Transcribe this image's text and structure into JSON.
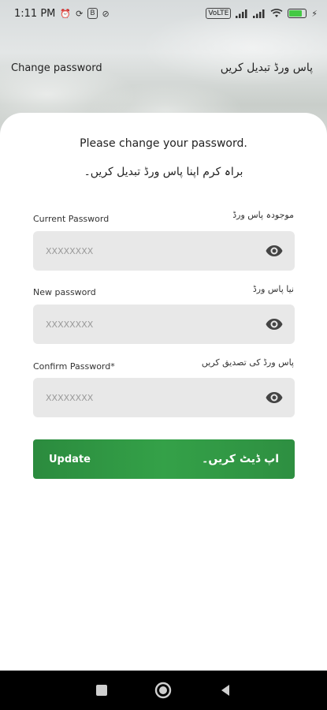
{
  "status_bar": {
    "time": "1:11 PM",
    "vo_lte": "VoLTE",
    "battery_level": 0.8,
    "icons": [
      "alarm-icon",
      "sync-icon",
      "b-icon",
      "vpn-icon",
      "signal-icon",
      "signal-icon",
      "wifi-icon",
      "battery-icon"
    ]
  },
  "header": {
    "title_en": "Change password",
    "title_ur": "پاس ورڈ تبدیل کریں"
  },
  "intro": {
    "heading_en": "Please change your password.",
    "heading_ur": "براہ کرم اپنا پاس ورڈ تبدیل کریں۔"
  },
  "fields": [
    {
      "label_en": "Current Password",
      "label_ur": "موجودہ پاس ورڈ",
      "placeholder": "XXXXXXXX"
    },
    {
      "label_en": "New password",
      "label_ur": "نیا پاس ورڈ",
      "placeholder": "XXXXXXXX"
    },
    {
      "label_en": "Confirm Password*",
      "label_ur": "پاس ورڈ کی تصدیق کریں",
      "placeholder": "XXXXXXXX"
    }
  ],
  "update_button": {
    "label_en": "Update",
    "label_ur": "اپ ڈیٹ کریں۔"
  },
  "colors": {
    "accent": "#2f9a45",
    "field_bg": "#e8e8e8",
    "nav_bg": "#000000"
  }
}
